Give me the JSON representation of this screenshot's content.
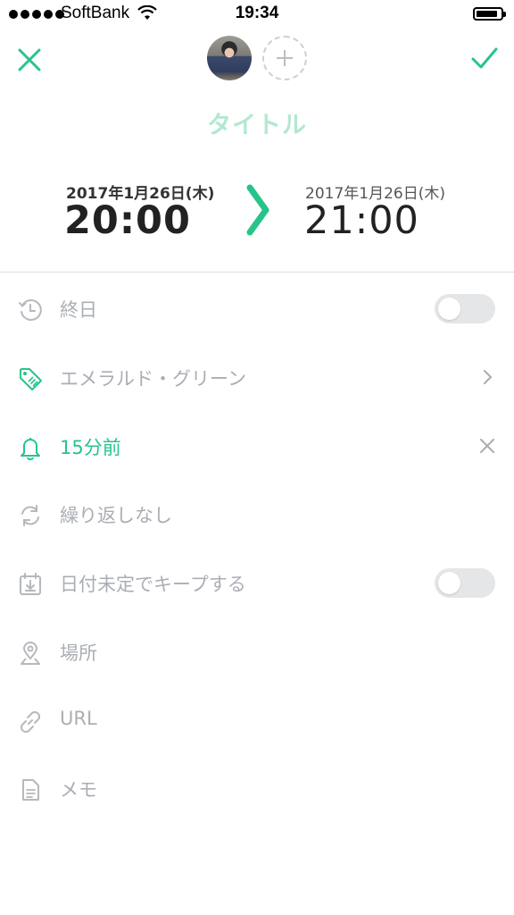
{
  "status_bar": {
    "carrier": "SoftBank",
    "time": "19:34",
    "battery_level": 0.9
  },
  "header": {
    "title_placeholder": "タイトル"
  },
  "schedule": {
    "start_date": "2017年1月26日(木)",
    "start_time": "20:00",
    "end_date": "2017年1月26日(木)",
    "end_time": "21:00"
  },
  "options": {
    "all_day_label": "終日",
    "all_day_on": false,
    "color_label": "エメラルド・グリーン",
    "reminder_label": "15分前",
    "repeat_label": "繰り返しなし",
    "keep_undecided_label": "日付未定でキープする",
    "keep_undecided_on": false,
    "location_label": "場所",
    "url_label": "URL",
    "memo_label": "メモ"
  },
  "colors": {
    "accent": "#27c48a",
    "title_placeholder": "#b3e8cf",
    "muted_text": "#aaaeb4",
    "icon_gray": "#b5b8bd"
  },
  "icons": [
    "close-icon",
    "check-icon",
    "add-member-icon",
    "chevron-right-icon",
    "clock-icon",
    "tag-icon",
    "bell-icon",
    "repeat-icon",
    "calendar-keep-icon",
    "location-pin-icon",
    "link-icon",
    "document-icon",
    "clear-icon"
  ]
}
